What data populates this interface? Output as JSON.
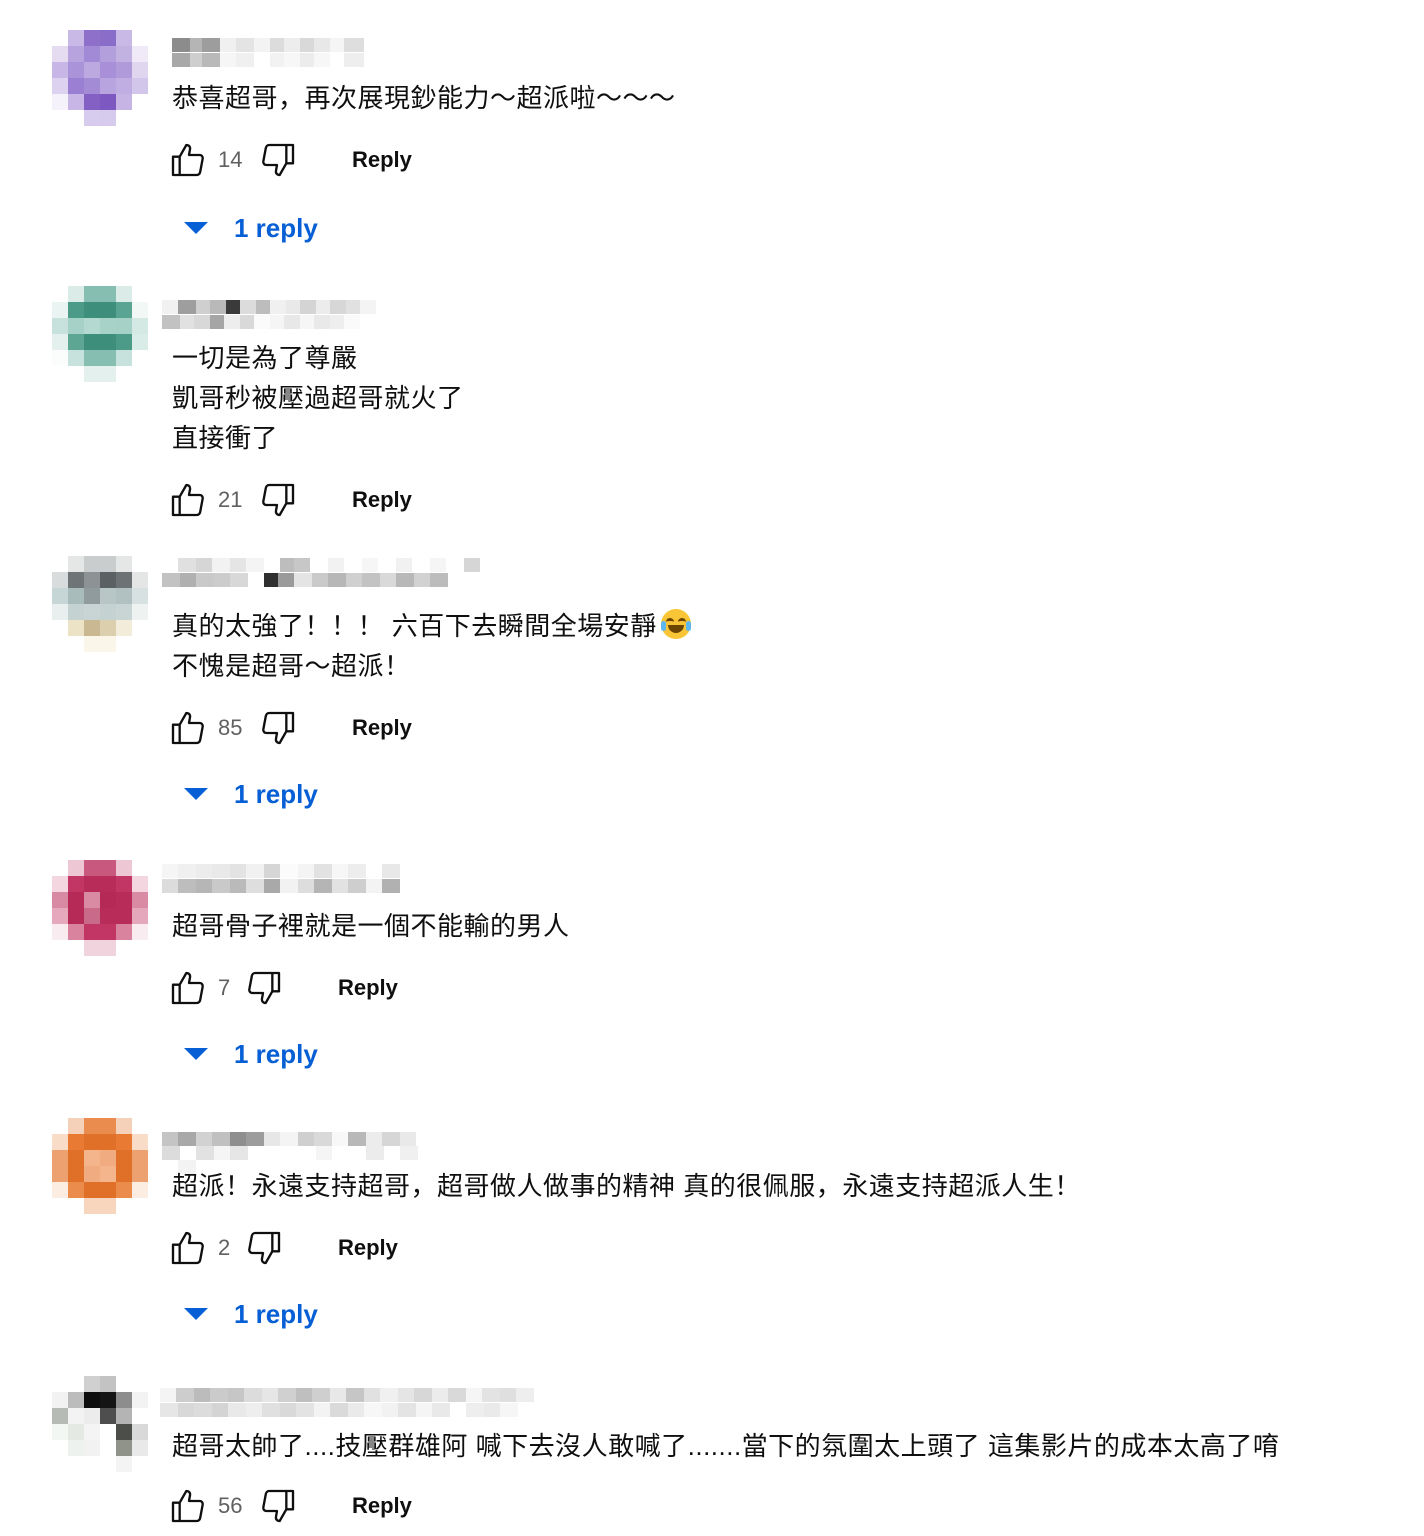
{
  "icons": {
    "like": "thumbs-up-icon",
    "dislike": "thumbs-down-icon",
    "expand": "caret-down-icon"
  },
  "accent_color": "#065fd4",
  "reply_label": "Reply",
  "comments": [
    {
      "avatar_colors": [
        "#ffffff",
        "#c9b9e6",
        "#8e6fc9",
        "#8a6cc9",
        "#c9b9e6",
        "#ffffff",
        "#e6dcf2",
        "#b7a4de",
        "#a38ad6",
        "#b39fdc",
        "#c2b2e2",
        "#f0eaf8",
        "#c7b6e6",
        "#ab93d9",
        "#bca9e0",
        "#a88fd7",
        "#b09ad9",
        "#e0d6f0",
        "#ddd2ef",
        "#9a7fd2",
        "#a48bd6",
        "#b8a4de",
        "#c0aee2",
        "#d2c6eb",
        "#f6f2fb",
        "#c7b6e6",
        "#8460c4",
        "#7d58c1",
        "#c6b4e5",
        "#ffffff",
        "#ffffff",
        "#ffffff",
        "#d8ccee",
        "#d6cbed",
        "#ffffff",
        "#ffffff"
      ],
      "text_lines": [
        "恭喜超哥，再次展現鈔能力～超派啦～～～"
      ],
      "likes": "14",
      "replies_label": "1 reply"
    },
    {
      "avatar_colors": [
        "#ffffff",
        "#dbece8",
        "#86bfb2",
        "#86bfb2",
        "#dbece8",
        "#ffffff",
        "#eaf4f2",
        "#4c9a88",
        "#3d8f7c",
        "#3d8f7c",
        "#5aa493",
        "#f1f8f6",
        "#c7e1dc",
        "#a5d1c7",
        "#b4d9d0",
        "#a7d2c8",
        "#a6d1c7",
        "#d5e9e4",
        "#e3f0ed",
        "#5ea694",
        "#3d8f7c",
        "#3d8f7c",
        "#4c9a88",
        "#d9ece7",
        "#fbfdfc",
        "#c7e1dc",
        "#86bfb2",
        "#86bfb2",
        "#c7e1dc",
        "#ffffff",
        "#ffffff",
        "#ffffff",
        "#e3f0ed",
        "#e3f0ed",
        "#ffffff",
        "#ffffff"
      ],
      "text_lines": [
        "一切是為了尊嚴",
        "凱哥秒被壓過超哥就火了",
        "直接衝了"
      ],
      "likes": "21",
      "replies_label": ""
    },
    {
      "avatar_colors": [
        "#ffffff",
        "#e5e6e6",
        "#c9cdcd",
        "#c9cdcd",
        "#e5e6e6",
        "#ffffff",
        "#d8dcdc",
        "#6f7476",
        "#8d9395",
        "#5b6062",
        "#6d7274",
        "#e4e6e6",
        "#c6d6d6",
        "#a9bcbc",
        "#8f9b9d",
        "#b8c6c6",
        "#b1c1c1",
        "#d7e1e1",
        "#e9efee",
        "#c4d2d2",
        "#c9d5d4",
        "#c4d2d2",
        "#c9d5d4",
        "#eef3f2",
        "#ffffff",
        "#ece2c6",
        "#c9b891",
        "#dccfae",
        "#f3ecda",
        "#ffffff",
        "#ffffff",
        "#ffffff",
        "#faf7ea",
        "#faf7ea",
        "#ffffff",
        "#ffffff"
      ],
      "text_lines": [
        "真的太強了！！！ 六百下去瞬間全場安靜",
        "不愧是超哥～超派！"
      ],
      "likes": "85",
      "replies_label": "1 reply"
    },
    {
      "avatar_colors": [
        "#ffffff",
        "#eec7d4",
        "#c8587e",
        "#c8587e",
        "#eec7d4",
        "#ffffff",
        "#f4d6e0",
        "#c13664",
        "#b82c5a",
        "#b82c5a",
        "#c13664",
        "#f4d6e0",
        "#d88aa4",
        "#b62a58",
        "#d98ba4",
        "#b52957",
        "#b82c5a",
        "#d98ba4",
        "#e5a8bd",
        "#b62a58",
        "#c96a8b",
        "#b82c5a",
        "#b82c5a",
        "#e4a7bc",
        "#f9ecf0",
        "#d9839f",
        "#c13664",
        "#c13664",
        "#d9839f",
        "#f9ecf0",
        "#ffffff",
        "#ffffff",
        "#f1d3dd",
        "#f1d3dd",
        "#ffffff",
        "#ffffff"
      ],
      "text_lines": [
        "超哥骨子裡就是一個不能輸的男人"
      ],
      "likes": "7",
      "replies_label": "1 reply"
    },
    {
      "avatar_colors": [
        "#ffffff",
        "#f6d1b9",
        "#ea8c4e",
        "#ea8c4e",
        "#f6d1b9",
        "#ffffff",
        "#f9dcc8",
        "#e87a33",
        "#e06f28",
        "#e06f28",
        "#e87a33",
        "#f9dcc8",
        "#eda070",
        "#e06f28",
        "#f4b48c",
        "#f0ab80",
        "#e06f28",
        "#eda070",
        "#eda070",
        "#e06f28",
        "#f0ab80",
        "#f4b48c",
        "#e06f28",
        "#eda070",
        "#fcede3",
        "#eb8c4d",
        "#e06f28",
        "#e06f28",
        "#eb8c4d",
        "#fcede3",
        "#ffffff",
        "#ffffff",
        "#f8d5bd",
        "#f8d5bd",
        "#ffffff",
        "#ffffff"
      ],
      "text_lines": [
        "超派！永遠支持超哥，超哥做人做事的精神 真的很佩服，永遠支持超派人生！"
      ],
      "likes": "2",
      "replies_label": "1 reply"
    },
    {
      "avatar_colors": [
        "#ffffff",
        "#ffffff",
        "#d0d0d0",
        "#c3c3c3",
        "#ffffff",
        "#ffffff",
        "#f2f2f2",
        "#bcbcbc",
        "#0d0d0d",
        "#141414",
        "#8d8d8d",
        "#f3f3f3",
        "#b6bbb6",
        "#f3f3f3",
        "#ececec",
        "#4e4e4e",
        "#b4b4b4",
        "#ffffff",
        "#f3f7f3",
        "#e4e9e4",
        "#f4f4f4",
        "#ffffff",
        "#4c4f49",
        "#d9d9d9",
        "#ffffff",
        "#eef2ee",
        "#f2f2f2",
        "#ffffff",
        "#8f9389",
        "#e9e9e9",
        "#ffffff",
        "#ffffff",
        "#ffffff",
        "#ffffff",
        "#f4f4f4",
        "#ffffff"
      ],
      "text_lines": [
        "超哥太帥了....技壓群雄阿 喊下去沒人敢喊了.......當下的氛圍太上頭了 這集影片的成本太高了唷"
      ],
      "likes": "56",
      "replies_label": ""
    }
  ]
}
